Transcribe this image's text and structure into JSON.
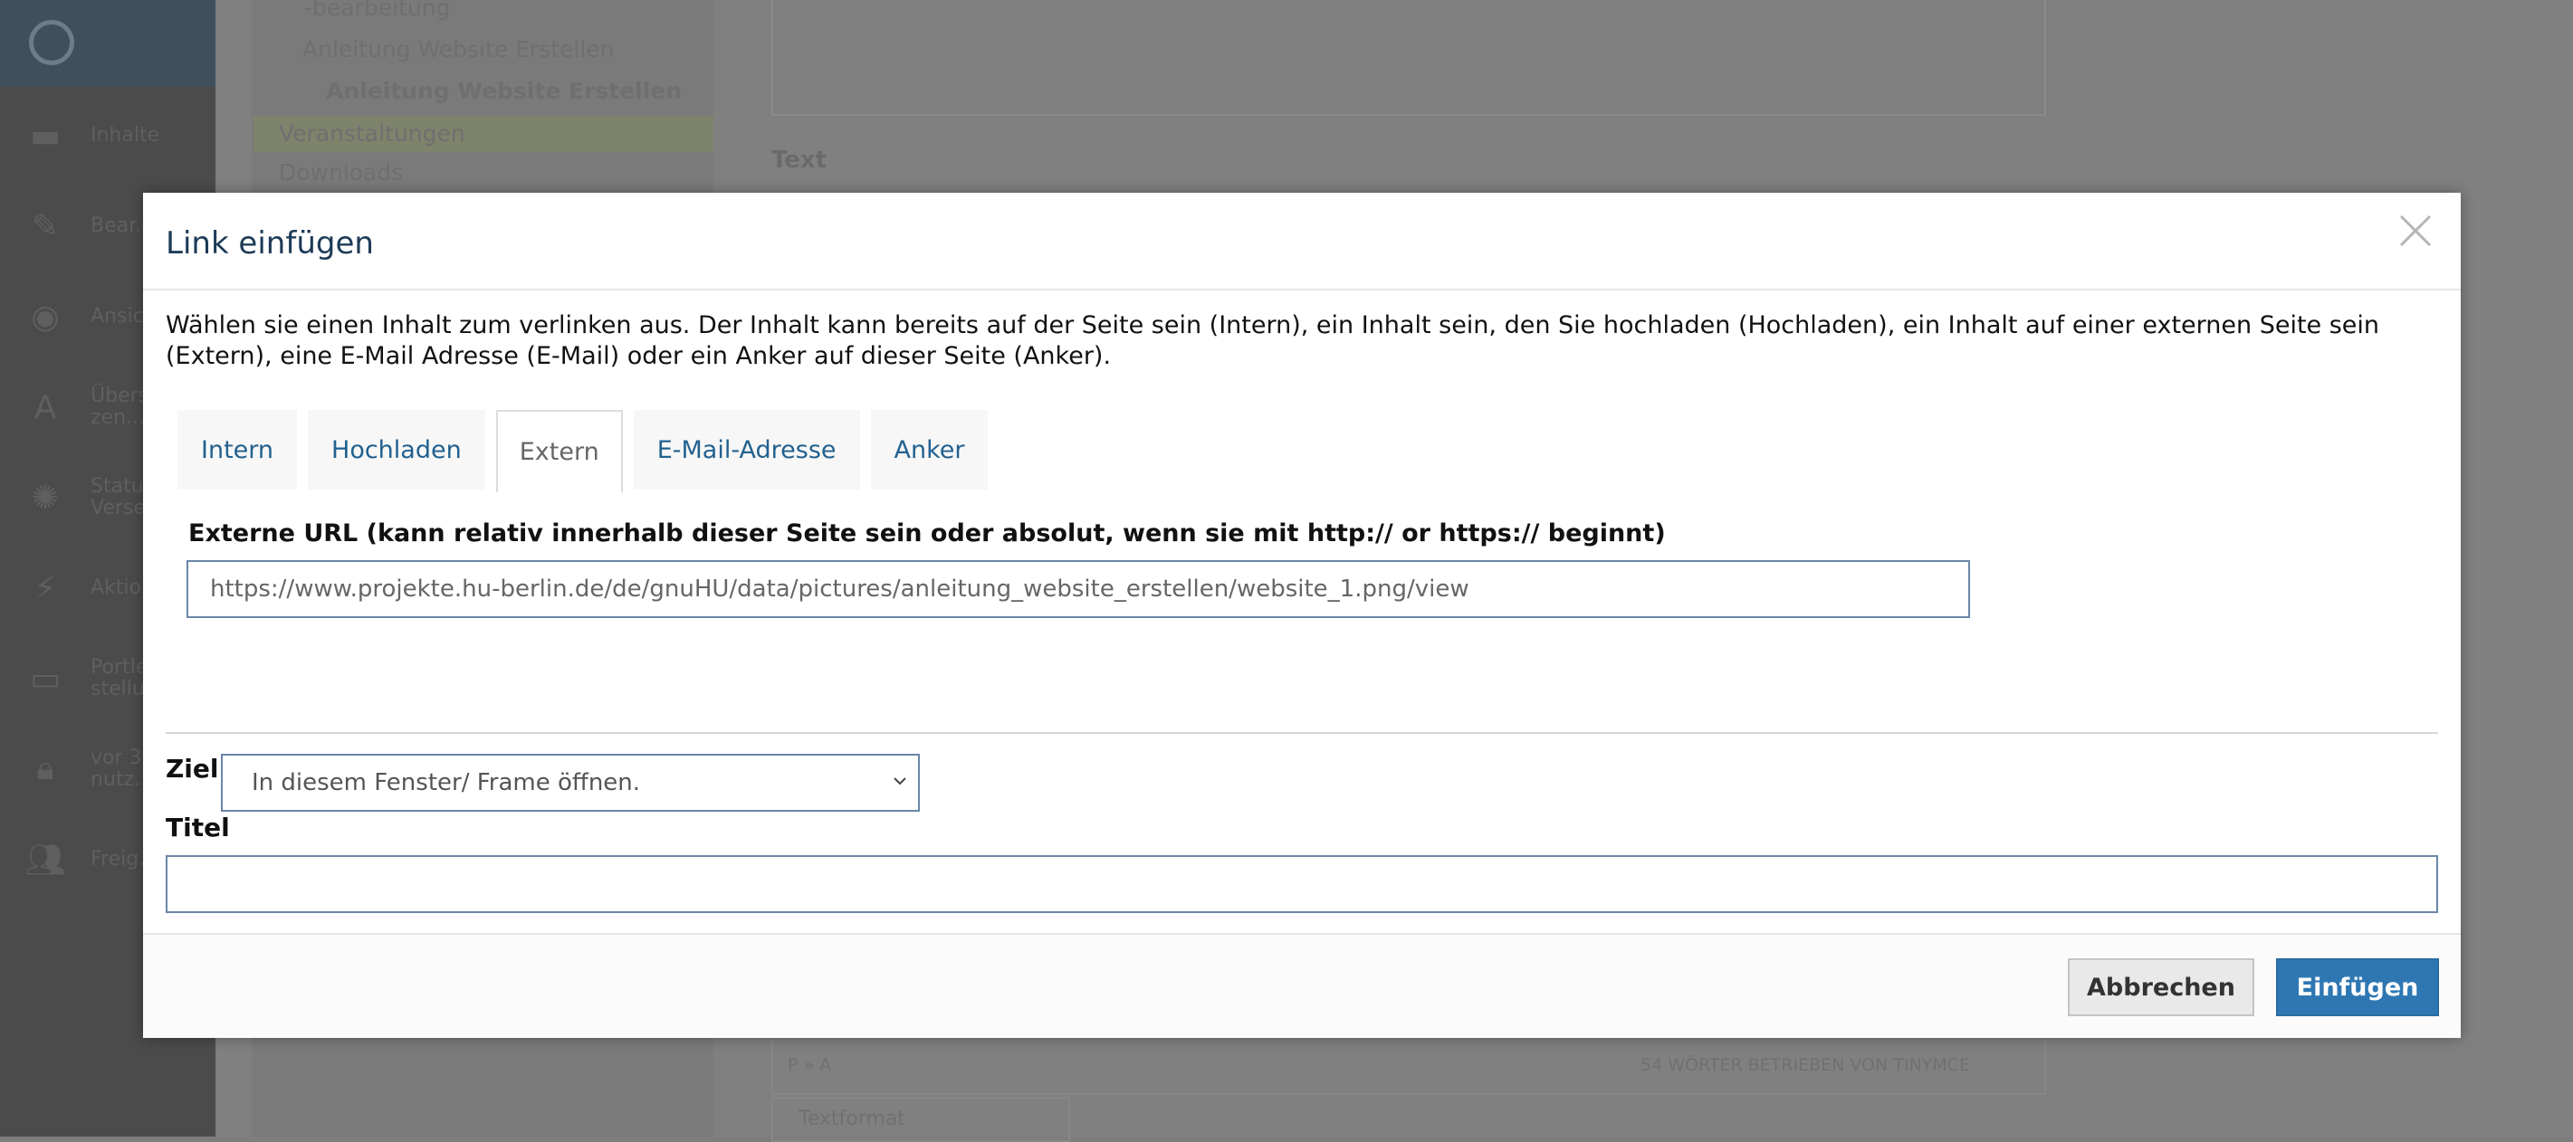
{
  "background": {
    "toolbar": {
      "items": [
        {
          "icon": "folder-icon",
          "label": "Inhalte"
        },
        {
          "icon": "pencil-icon",
          "label": "Bear..."
        },
        {
          "icon": "eye-icon",
          "label": "Ansic..."
        },
        {
          "icon": "translate-icon",
          "label": "Überse...\nzen..."
        },
        {
          "icon": "status-icon",
          "label": "Status:\nVerse..."
        },
        {
          "icon": "lightning-icon",
          "label": "Aktion..."
        },
        {
          "icon": "display-icon",
          "label": "Portlet-\nstellu..."
        },
        {
          "icon": "lock-icon",
          "label": "vor 3\nnutz..."
        },
        {
          "icon": "users-icon",
          "label": "Freig..."
        }
      ]
    },
    "nav": [
      "-bearbeitung",
      "Anleitung Website Erstellen",
      "Anleitung Website Erstellen",
      "Veranstaltungen",
      "Downloads"
    ],
    "text_label": "Text",
    "footer_left": "P » A",
    "footer_right": "54 WÖRTER BETRIEBEN VON TINYMCE",
    "format_select": "Textformat"
  },
  "dialog": {
    "title": "Link einfügen",
    "intro": "Wählen sie einen Inhalt zum verlinken aus. Der Inhalt kann bereits auf der Seite sein (Intern), ein Inhalt sein, den Sie hochladen (Hochladen), ein Inhalt auf einer externen Seite sein (Extern), eine E-Mail Adresse (E-Mail) oder ein Anker auf dieser Seite (Anker).",
    "tabs": [
      {
        "label": "Intern",
        "active": false
      },
      {
        "label": "Hochladen",
        "active": false
      },
      {
        "label": "Extern",
        "active": true
      },
      {
        "label": "E-Mail-Adresse",
        "active": false
      },
      {
        "label": "Anker",
        "active": false
      }
    ],
    "external_url": {
      "label": "Externe URL (kann relativ innerhalb dieser Seite sein oder absolut, wenn sie mit http:// or https:// beginnt)",
      "value": "https://www.projekte.hu-berlin.de/de/gnuHU/data/pictures/anleitung_website_erstellen/website_1.png/view"
    },
    "target": {
      "label": "Ziel",
      "selected": "In diesem Fenster/ Frame öffnen."
    },
    "title_field": {
      "label": "Titel",
      "value": ""
    },
    "buttons": {
      "cancel": "Abbrechen",
      "insert": "Einfügen"
    }
  },
  "colors": {
    "accent": "#2e77b3",
    "tab_link": "#22618f",
    "title": "#1d3b57",
    "input_border": "#6a86a8"
  }
}
